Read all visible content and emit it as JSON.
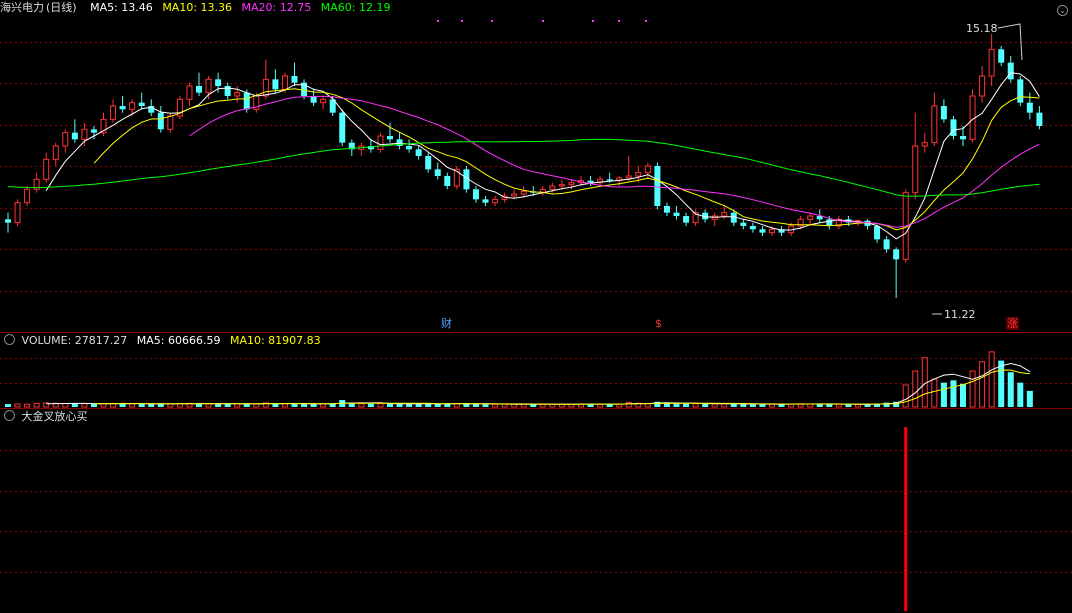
{
  "main": {
    "stock_name": "海兴电力",
    "period": "(日线)",
    "ma": [
      {
        "label": "MA5: 13.46",
        "color": "#ffffff"
      },
      {
        "label": "MA10: 13.36",
        "color": "#ffff00"
      },
      {
        "label": "MA20: 12.75",
        "color": "#ff33ff"
      },
      {
        "label": "MA60: 12.19",
        "color": "#00ff00"
      }
    ],
    "high_label": "15.18",
    "low_label": "11.22",
    "event_tags": [
      {
        "text": "财",
        "color": "#4fa3ff"
      },
      {
        "text": "$",
        "color": "#ff3333"
      },
      {
        "text": "涨",
        "color": "#ff3333"
      }
    ]
  },
  "volume": {
    "title": "VOLUME: 27817.27",
    "ma5": "MA5: 60666.59",
    "ma10": "MA10: 81907.83"
  },
  "indicator": {
    "title": "大金叉放心买"
  },
  "colors": {
    "up": "#ff3333",
    "down": "#54ffff",
    "grid": "#8b0000",
    "ma5": "#ffffff",
    "ma10": "#ffff00",
    "ma20": "#ff33ff",
    "ma60": "#00ff00",
    "signal": "#ff0000"
  },
  "chart_data": {
    "type": "candlestick",
    "ohlc": [
      [
        12.4,
        12.5,
        12.2,
        12.35
      ],
      [
        12.35,
        12.7,
        12.3,
        12.65
      ],
      [
        12.65,
        12.9,
        12.6,
        12.85
      ],
      [
        12.85,
        13.1,
        12.8,
        13.0
      ],
      [
        13.0,
        13.4,
        12.95,
        13.3
      ],
      [
        13.3,
        13.55,
        13.2,
        13.5
      ],
      [
        13.5,
        13.75,
        13.4,
        13.7
      ],
      [
        13.7,
        13.9,
        13.55,
        13.6
      ],
      [
        13.6,
        13.85,
        13.5,
        13.75
      ],
      [
        13.75,
        13.8,
        13.6,
        13.7
      ],
      [
        13.7,
        14.0,
        13.65,
        13.9
      ],
      [
        13.9,
        14.2,
        13.85,
        14.1
      ],
      [
        14.1,
        14.25,
        14.0,
        14.05
      ],
      [
        14.05,
        14.2,
        13.95,
        14.15
      ],
      [
        14.15,
        14.3,
        14.05,
        14.1
      ],
      [
        14.1,
        14.2,
        13.95,
        14.0
      ],
      [
        14.0,
        14.1,
        13.7,
        13.75
      ],
      [
        13.75,
        14.0,
        13.7,
        13.95
      ],
      [
        13.95,
        14.25,
        13.9,
        14.2
      ],
      [
        14.2,
        14.45,
        14.1,
        14.4
      ],
      [
        14.4,
        14.6,
        14.25,
        14.3
      ],
      [
        14.3,
        14.55,
        14.2,
        14.5
      ],
      [
        14.5,
        14.6,
        14.3,
        14.4
      ],
      [
        14.4,
        14.45,
        14.2,
        14.25
      ],
      [
        14.25,
        14.4,
        14.15,
        14.3
      ],
      [
        14.3,
        14.35,
        14.0,
        14.05
      ],
      [
        14.05,
        14.3,
        14.0,
        14.25
      ],
      [
        14.25,
        14.8,
        14.2,
        14.5
      ],
      [
        14.5,
        14.65,
        14.3,
        14.35
      ],
      [
        14.35,
        14.6,
        14.3,
        14.55
      ],
      [
        14.55,
        14.75,
        14.4,
        14.45
      ],
      [
        14.45,
        14.5,
        14.2,
        14.25
      ],
      [
        14.25,
        14.35,
        14.1,
        14.15
      ],
      [
        14.15,
        14.25,
        14.05,
        14.2
      ],
      [
        14.2,
        14.25,
        13.95,
        14.0
      ],
      [
        14.0,
        14.05,
        13.5,
        13.55
      ],
      [
        13.55,
        13.6,
        13.35,
        13.45
      ],
      [
        13.45,
        13.55,
        13.35,
        13.5
      ],
      [
        13.5,
        13.6,
        13.4,
        13.45
      ],
      [
        13.45,
        13.7,
        13.4,
        13.65
      ],
      [
        13.65,
        13.85,
        13.55,
        13.6
      ],
      [
        13.6,
        13.7,
        13.45,
        13.5
      ],
      [
        13.5,
        13.6,
        13.4,
        13.45
      ],
      [
        13.45,
        13.5,
        13.3,
        13.35
      ],
      [
        13.35,
        13.4,
        13.1,
        13.15
      ],
      [
        13.15,
        13.25,
        13.0,
        13.05
      ],
      [
        13.05,
        13.1,
        12.85,
        12.9
      ],
      [
        12.9,
        13.2,
        12.85,
        13.15
      ],
      [
        13.15,
        13.2,
        12.8,
        12.85
      ],
      [
        12.85,
        12.9,
        12.65,
        12.7
      ],
      [
        12.7,
        12.75,
        12.6,
        12.65
      ],
      [
        12.65,
        12.75,
        12.6,
        12.7
      ],
      [
        12.7,
        12.8,
        12.65,
        12.75
      ],
      [
        12.75,
        12.85,
        12.7,
        12.78
      ],
      [
        12.78,
        12.9,
        12.72,
        12.82
      ],
      [
        12.82,
        12.9,
        12.75,
        12.8
      ],
      [
        12.8,
        12.9,
        12.75,
        12.85
      ],
      [
        12.85,
        12.95,
        12.8,
        12.9
      ],
      [
        12.9,
        13.0,
        12.85,
        12.92
      ],
      [
        12.92,
        13.0,
        12.85,
        12.95
      ],
      [
        12.95,
        13.05,
        12.9,
        12.98
      ],
      [
        12.98,
        13.05,
        12.9,
        12.95
      ],
      [
        12.95,
        13.05,
        12.9,
        13.0
      ],
      [
        13.0,
        13.1,
        12.95,
        12.98
      ],
      [
        12.98,
        13.05,
        12.9,
        13.02
      ],
      [
        13.02,
        13.35,
        12.98,
        13.05
      ],
      [
        13.05,
        13.2,
        12.95,
        13.1
      ],
      [
        13.1,
        13.25,
        13.0,
        13.2
      ],
      [
        13.2,
        13.25,
        12.55,
        12.6
      ],
      [
        12.6,
        12.65,
        12.45,
        12.5
      ],
      [
        12.5,
        12.6,
        12.4,
        12.45
      ],
      [
        12.45,
        12.5,
        12.3,
        12.35
      ],
      [
        12.35,
        12.55,
        12.3,
        12.5
      ],
      [
        12.5,
        12.55,
        12.35,
        12.4
      ],
      [
        12.4,
        12.5,
        12.3,
        12.45
      ],
      [
        12.45,
        12.6,
        12.4,
        12.5
      ],
      [
        12.5,
        12.55,
        12.3,
        12.35
      ],
      [
        12.35,
        12.4,
        12.25,
        12.3
      ],
      [
        12.3,
        12.35,
        12.2,
        12.25
      ],
      [
        12.25,
        12.3,
        12.15,
        12.2
      ],
      [
        12.2,
        12.3,
        12.15,
        12.25
      ],
      [
        12.25,
        12.3,
        12.15,
        12.2
      ],
      [
        12.2,
        12.35,
        12.15,
        12.3
      ],
      [
        12.3,
        12.45,
        12.25,
        12.4
      ],
      [
        12.4,
        12.5,
        12.3,
        12.45
      ],
      [
        12.45,
        12.55,
        12.35,
        12.4
      ],
      [
        12.4,
        12.45,
        12.25,
        12.3
      ],
      [
        12.3,
        12.45,
        12.25,
        12.4
      ],
      [
        12.4,
        12.45,
        12.3,
        12.35
      ],
      [
        12.35,
        12.4,
        12.3,
        12.38
      ],
      [
        12.38,
        12.4,
        12.25,
        12.3
      ],
      [
        12.3,
        12.32,
        12.05,
        12.1
      ],
      [
        12.1,
        12.15,
        11.9,
        11.95
      ],
      [
        11.95,
        11.98,
        11.22,
        11.8
      ],
      [
        11.8,
        12.85,
        11.75,
        12.8
      ],
      [
        12.8,
        14.0,
        12.7,
        13.5
      ],
      [
        13.5,
        13.7,
        13.4,
        13.55
      ],
      [
        13.55,
        14.3,
        13.5,
        14.1
      ],
      [
        14.1,
        14.2,
        13.85,
        13.9
      ],
      [
        13.9,
        13.95,
        13.6,
        13.65
      ],
      [
        13.65,
        13.8,
        13.5,
        13.6
      ],
      [
        13.6,
        14.35,
        13.55,
        14.25
      ],
      [
        14.25,
        14.7,
        14.15,
        14.55
      ],
      [
        14.55,
        15.18,
        14.4,
        14.95
      ],
      [
        14.95,
        15.0,
        14.7,
        14.75
      ],
      [
        14.75,
        14.85,
        14.45,
        14.5
      ],
      [
        14.5,
        14.55,
        14.1,
        14.15
      ],
      [
        14.15,
        14.3,
        13.9,
        14.0
      ],
      [
        14.0,
        14.1,
        13.75,
        13.8
      ]
    ],
    "volume": [
      5000,
      5200,
      4800,
      6000,
      7000,
      6500,
      6000,
      5800,
      5500,
      5200,
      6000,
      6200,
      5800,
      5500,
      5400,
      5600,
      5200,
      5300,
      6000,
      6400,
      6000,
      5800,
      5500,
      5200,
      5400,
      5600,
      5300,
      7000,
      6000,
      5800,
      6200,
      5600,
      5200,
      5100,
      5400,
      12000,
      7000,
      5600,
      5500,
      6000,
      5800,
      5400,
      5300,
      5200,
      5600,
      5800,
      5400,
      6000,
      6500,
      5000,
      4800,
      4600,
      4700,
      4900,
      5000,
      4800,
      4700,
      4900,
      5100,
      5000,
      5200,
      5000,
      4900,
      5100,
      5000,
      8000,
      6500,
      6000,
      9000,
      7000,
      6000,
      5800,
      5500,
      5400,
      5200,
      5600,
      5800,
      5000,
      4800,
      4700,
      4900,
      5000,
      5200,
      5600,
      5400,
      5100,
      5000,
      4900,
      4800,
      4700,
      4600,
      6000,
      7500,
      9000,
      38000,
      62000,
      85000,
      48000,
      42000,
      46000,
      40000,
      62000,
      78000,
      95000,
      80000,
      60000,
      42000,
      27817.27
    ],
    "signal_bar_index": 94
  }
}
